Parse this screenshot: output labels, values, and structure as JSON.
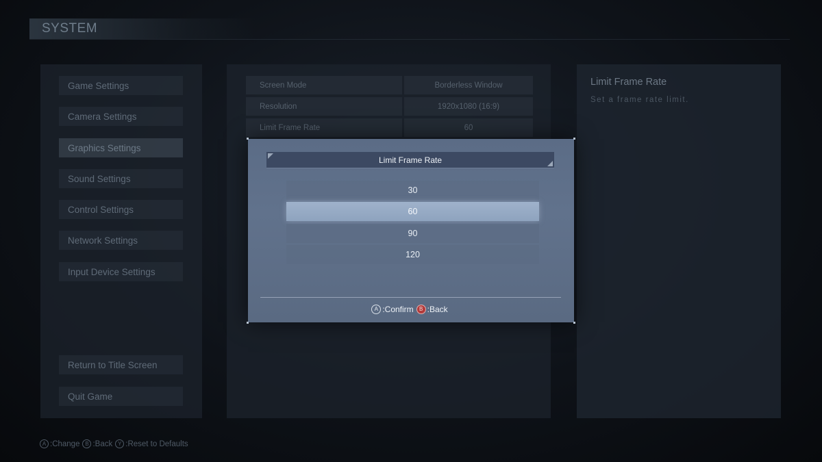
{
  "header": {
    "title": "SYSTEM"
  },
  "menu": {
    "items": [
      {
        "label": "Game Settings"
      },
      {
        "label": "Camera Settings"
      },
      {
        "label": "Graphics Settings"
      },
      {
        "label": "Sound Settings"
      },
      {
        "label": "Control Settings"
      },
      {
        "label": "Network Settings"
      },
      {
        "label": "Input Device Settings"
      }
    ],
    "selected_index": 2,
    "bottom_items": [
      {
        "label": "Return to Title Screen"
      },
      {
        "label": "Quit Game"
      }
    ]
  },
  "settings": [
    {
      "name": "Screen Mode",
      "value": "Borderless Window"
    },
    {
      "name": "Resolution",
      "value": "1920x1080 (16:9)"
    },
    {
      "name": "Limit Frame Rate",
      "value": "60"
    }
  ],
  "description": {
    "title": "Limit Frame Rate",
    "text": "Set a frame rate limit."
  },
  "bottom_hints": [
    {
      "button": "A",
      "label": ":Change"
    },
    {
      "button": "B",
      "label": ":Back"
    },
    {
      "button": "Y",
      "label": ":Reset to Defaults"
    }
  ],
  "modal": {
    "title": "Limit Frame Rate",
    "options": [
      "30",
      "60",
      "90",
      "120"
    ],
    "selected_index": 1,
    "hints": [
      {
        "button": "A",
        "label": ":Confirm"
      },
      {
        "button": "B",
        "label": ":Back"
      }
    ]
  },
  "colors": {
    "modal_bg": "#5b6c86",
    "modal_title_bg": "#3c4962",
    "option_selected": "#9fb2cb",
    "b_button": "#b23a3a"
  }
}
